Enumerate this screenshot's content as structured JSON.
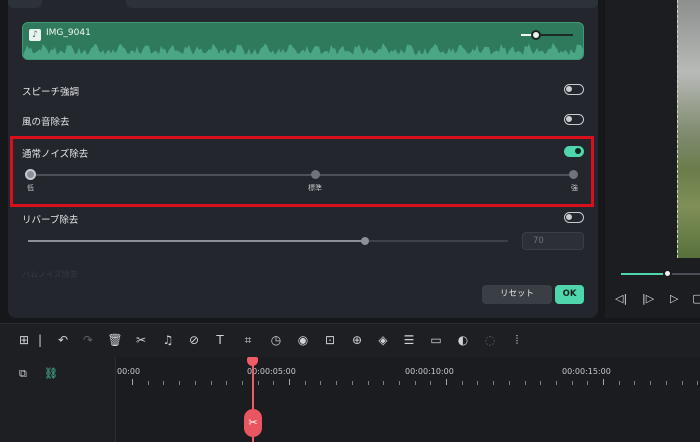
{
  "clip": {
    "name": "IMG_9041",
    "icon": "music-note-icon",
    "color": "#2f7a5d"
  },
  "settings": {
    "speech_enhancement": {
      "label": "スピーチ強調",
      "enabled": false
    },
    "wind_removal": {
      "label": "風の音除去",
      "enabled": false
    },
    "noise_removal": {
      "label": "通常ノイズ除去",
      "enabled": true,
      "level_labels": {
        "low": "低",
        "mid": "標準",
        "high": "強"
      },
      "level": "低"
    },
    "reverb_removal": {
      "label": "リバーブ除去",
      "enabled": false,
      "value": "70"
    },
    "faded_row": {
      "label": "ハムノイズ除去"
    }
  },
  "buttons": {
    "reset": "リセット",
    "ok": "OK"
  },
  "timeline": {
    "times": [
      "00:00",
      "00:00:05:00",
      "00:00:10:00",
      "00:00:15:00"
    ]
  },
  "colors": {
    "accent": "#4fd6ad",
    "highlight": "#d90f1d",
    "playhead": "#ee5c66"
  }
}
